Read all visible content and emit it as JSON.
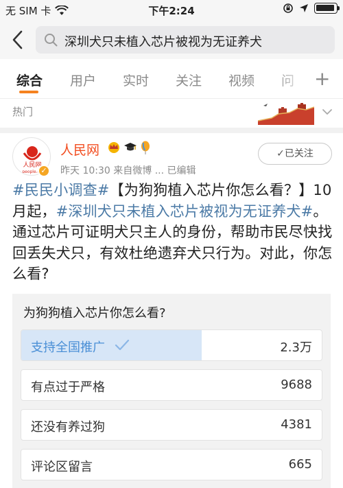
{
  "status_bar": {
    "carrier": "无 SIM 卡",
    "time": "下午2:24"
  },
  "search": {
    "query": "深圳犬只未植入芯片被视为无证养犬"
  },
  "tabs": [
    "综合",
    "用户",
    "实时",
    "关注",
    "视频",
    "问"
  ],
  "hot": {
    "label": "热门"
  },
  "post": {
    "author": "人民网",
    "avatar_text": "人民网",
    "avatar_sub": "people.cn",
    "meta": "昨天 10:30  来自微博 ... 已编辑",
    "follow_label": "✓已关注",
    "text": {
      "tag1": "#民民小调查#",
      "part1": "【为狗狗植入芯片你怎么看？】10月起，",
      "tag2": "#深圳犬只未植入芯片被视为无证养犬#",
      "part2": "。通过芯片可证明犬只主人的身份，帮助市民尽快找回丢失犬只，有效杜绝遗弃犬只行为。对此，你怎么看?"
    }
  },
  "poll": {
    "question": "为狗狗植入芯片你怎么看?",
    "options": [
      {
        "label": "支持全国推广",
        "count": "2.3万",
        "selected": true,
        "share": 0.6
      },
      {
        "label": "有点过于严格",
        "count": "9688",
        "selected": false,
        "share": 0
      },
      {
        "label": "还没有养过狗",
        "count": "4381",
        "selected": false,
        "share": 0
      },
      {
        "label": "评论区留言",
        "count": "665",
        "selected": false,
        "share": 0
      }
    ]
  },
  "colors": {
    "accent": "#f58220",
    "author": "#f24d20",
    "link": "#4b7aa6",
    "poll_fill": "#d7e6f7"
  }
}
